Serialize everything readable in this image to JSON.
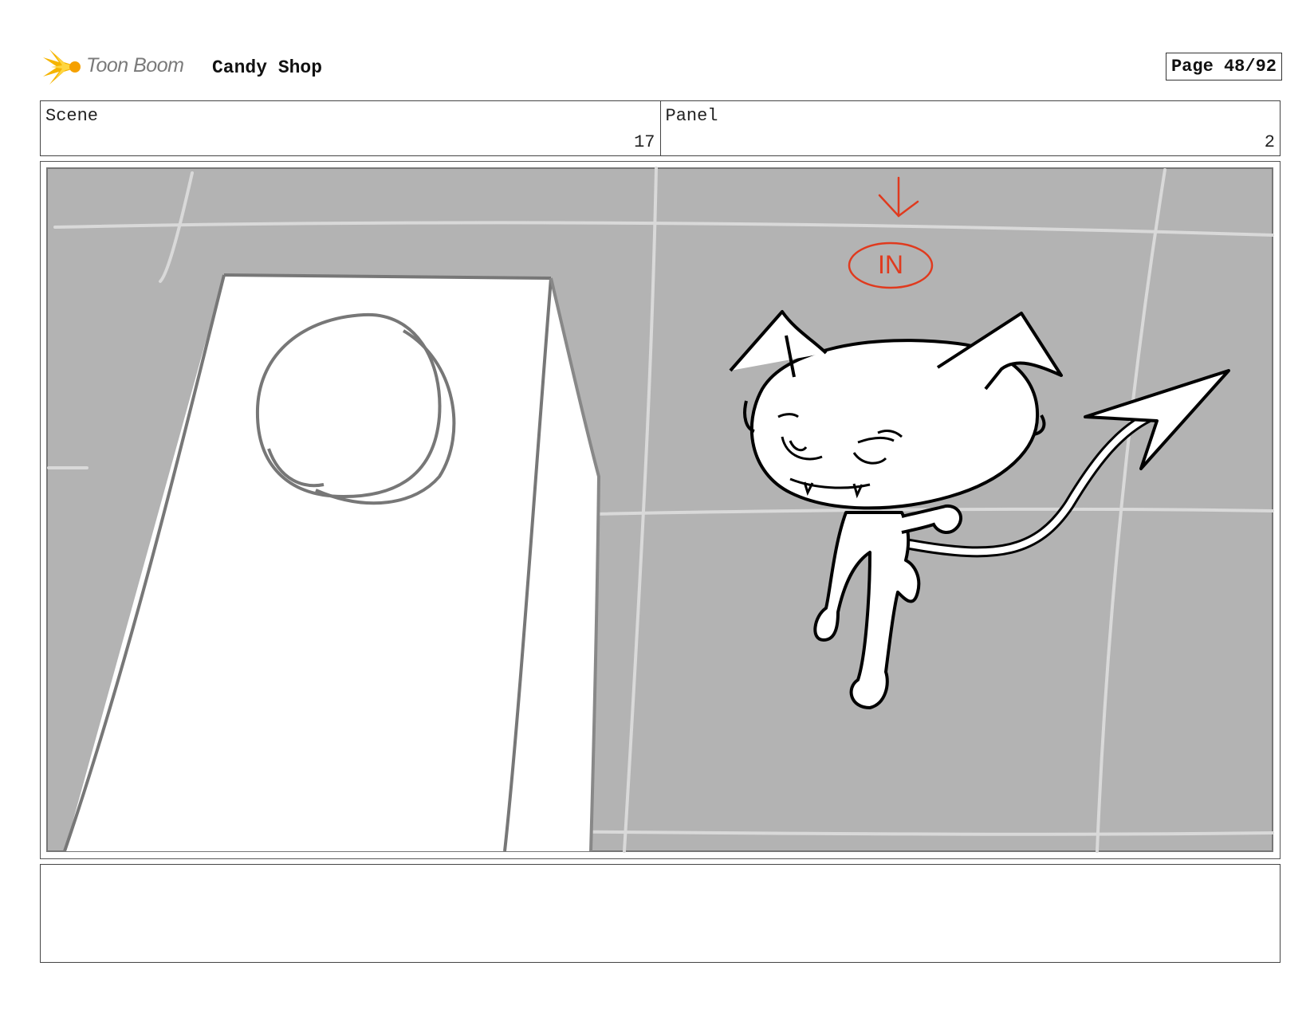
{
  "header": {
    "logo_text": "Toon Boom",
    "project_title": "Candy Shop",
    "page_label": "Page 48/92"
  },
  "panel_info": {
    "scene_label": "Scene",
    "scene_number": "17",
    "panel_label": "Panel",
    "panel_number": "2"
  },
  "sketch": {
    "annotation_text": "IN",
    "annotation_color": "#e03a1e",
    "background_color": "#b3b3b3"
  },
  "notes": {
    "text": ""
  }
}
